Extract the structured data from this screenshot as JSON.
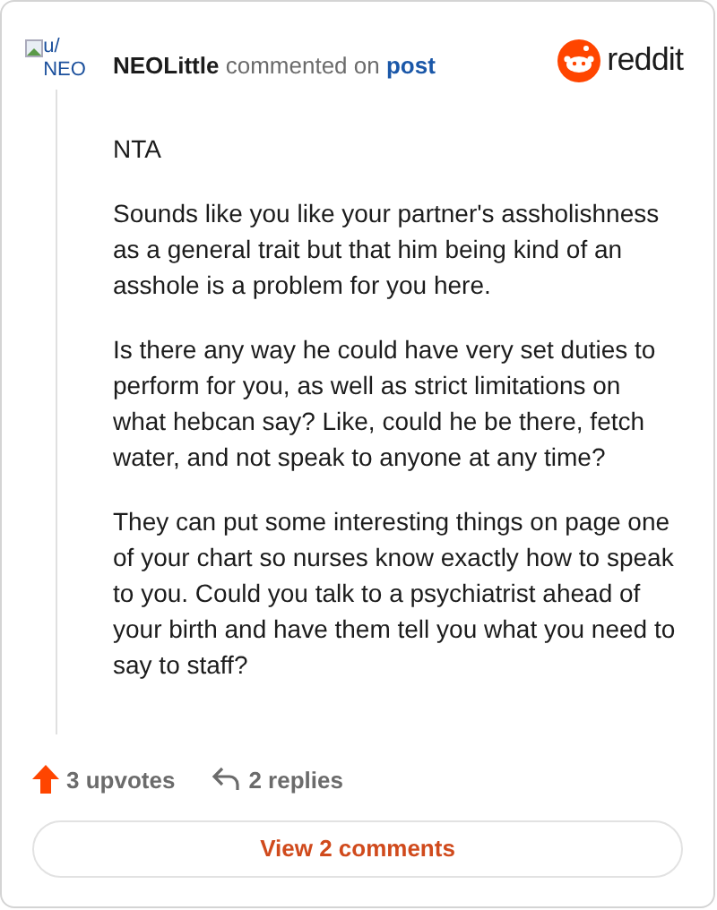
{
  "avatar": {
    "alt_text": "u/\nNEO"
  },
  "header": {
    "username": "NEOLittle",
    "action": "commented on",
    "link": "post",
    "brand": "reddit"
  },
  "comment": {
    "paragraphs": [
      "NTA",
      "Sounds like you like your partner's assholishness as a general trait but that him being kind of an asshole is a problem for you here.",
      "Is there any way he could have very set duties to perform for you, as well as strict limitations on what hebcan say? Like, could he be there, fetch water, and not speak to anyone at any time?",
      "They can put some interesting things on page one of your chart so nurses know exactly how to speak to you. Could you talk to a psychiatrist ahead of your birth and have them tell you what you need to say to staff?"
    ]
  },
  "footer": {
    "upvotes": "3 upvotes",
    "replies": "2 replies"
  },
  "button": {
    "label": "View 2 comments"
  }
}
